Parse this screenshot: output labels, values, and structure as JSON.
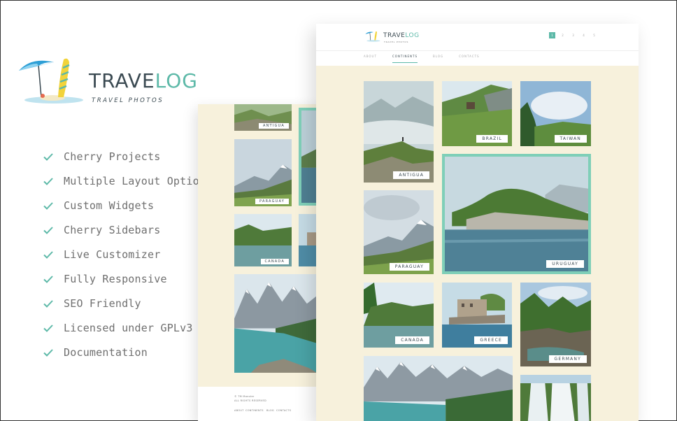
{
  "brand": {
    "name_part1": "TRAVE",
    "name_part2": "LOG",
    "tagline": "TRAVEL PHOTOS",
    "logo_icon": "beach-umbrella-surfboard-icon",
    "colors": {
      "dark": "#3b4a52",
      "accent": "#5db9a8"
    }
  },
  "features": [
    {
      "label": "Cherry Projects",
      "icon": "check-icon"
    },
    {
      "label": "Multiple Layout Options",
      "icon": "check-icon"
    },
    {
      "label": "Custom Widgets",
      "icon": "check-icon"
    },
    {
      "label": "Cherry Sidebars",
      "icon": "check-icon"
    },
    {
      "label": "Live Customizer",
      "icon": "check-icon"
    },
    {
      "label": "Fully Responsive",
      "icon": "check-icon"
    },
    {
      "label": "SEO Friendly",
      "icon": "check-icon"
    },
    {
      "label": "Licensed under GPLv3",
      "icon": "check-icon"
    },
    {
      "label": "Documentation",
      "icon": "check-icon"
    }
  ],
  "front_page": {
    "logo_part1": "TRAVE",
    "logo_part2": "LOG",
    "logo_tagline": "TRAVEL PHOTOS",
    "pager": [
      "1",
      "2",
      "3",
      "4",
      "5"
    ],
    "nav": [
      "ABOUT",
      "CONTINENTS",
      "BLOG",
      "CONTACTS"
    ],
    "active_nav": "CONTINENTS",
    "tiles": {
      "antigua": "ANTIGUA",
      "brazil": "BRAZIL",
      "taiwan": "TAIWAN",
      "paraguay": "PARAGUAY",
      "uruguay": "URUGUAY",
      "canada": "CANADA",
      "greece": "GREECE",
      "germany": "GERMANY"
    }
  },
  "back_page": {
    "tiles": {
      "antigua": "ANTIGUA",
      "paraguay": "PARAGUAY",
      "canada": "CANADA"
    },
    "footer_lines": [
      "© TM Monster",
      "ALL RIGHTS RESERVED"
    ],
    "footer_nav": [
      "ABOUT",
      "CONTINENTS",
      "BLOG",
      "CONTACTS"
    ]
  }
}
